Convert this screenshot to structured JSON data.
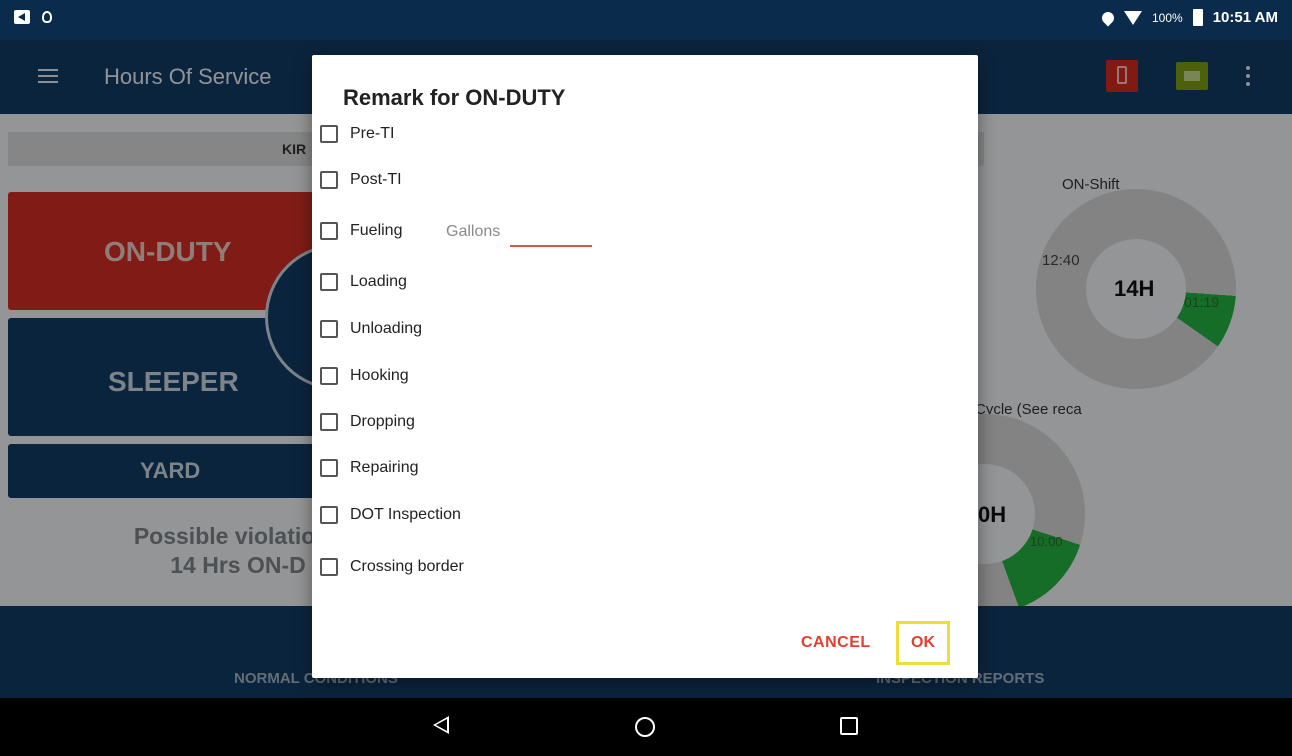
{
  "status_bar": {
    "battery_pct": "100%",
    "time": "10:51 AM"
  },
  "app_bar": {
    "title": "Hours Of Service"
  },
  "background": {
    "driver_name_partial": "KIR",
    "on_duty_label": "ON-DUTY",
    "sleeper_label": "SLEEPER",
    "yard_label": "YARD",
    "violation_line1": "Possible violation i",
    "violation_line2": "14 Hrs ON-D",
    "on_shift_label": "ON-Shift",
    "on_shift_center": "14H",
    "on_shift_left_value": "12:40",
    "on_shift_green_value": "01:19",
    "cycle_label": "Cycle (See reca",
    "cycle_center": "0H",
    "cycle_green_value": "10:00"
  },
  "bottom_tabs": {
    "left_label": "NORMAL CONDITIONS",
    "right_label": "INSPECTION REPORTS"
  },
  "dialog": {
    "title": "Remark for ON-DUTY",
    "options": [
      {
        "label": "Pre-TI",
        "checked": false
      },
      {
        "label": "Post-TI",
        "checked": false
      },
      {
        "label": "Fueling",
        "checked": false
      },
      {
        "label": "Loading",
        "checked": false
      },
      {
        "label": "Unloading",
        "checked": false
      },
      {
        "label": "Hooking",
        "checked": false
      },
      {
        "label": "Dropping",
        "checked": false
      },
      {
        "label": "Repairing",
        "checked": false
      },
      {
        "label": "DOT Inspection",
        "checked": false
      },
      {
        "label": "Crossing border",
        "checked": false
      }
    ],
    "gallons_label": "Gallons",
    "gallons_value": "",
    "cancel_label": "CANCEL",
    "ok_label": "OK"
  },
  "colors": {
    "primary_dark": "#123b63",
    "on_duty_red": "#cf2e22",
    "accent_red": "#e0402f",
    "progress_green": "#22b03f",
    "highlight_yellow": "#f0dc3c"
  }
}
